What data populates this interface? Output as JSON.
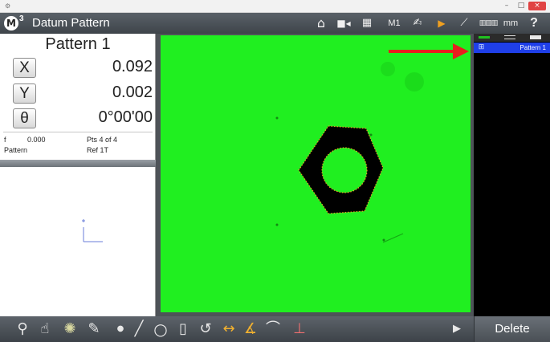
{
  "window": {
    "icon": "app-small-icon",
    "minimize": "–",
    "maximize": "□",
    "close": "×"
  },
  "title_bar": {
    "logo": "M",
    "logo_sup": "3",
    "title": "Datum Pattern",
    "m1": "M1",
    "unit": "mm",
    "help": "?",
    "icons": [
      "home-icon",
      "video-icon",
      "grid-icon",
      "probe-icon",
      "play-icon",
      "stylus-icon",
      "ruler-icon",
      "help-icon"
    ]
  },
  "dro": {
    "title": "Pattern 1",
    "x_label": "X",
    "x_value": "0.092",
    "y_label": "Y",
    "y_value": "0.002",
    "theta_label": "θ",
    "theta_value": "0°00'00"
  },
  "info": {
    "f_label": "f",
    "f_value": "0.000",
    "points": "Pts 4 of 4",
    "type": "Pattern",
    "ref": "Ref 1T"
  },
  "feature_list": {
    "items": [
      {
        "label": "Pattern 1",
        "icon": "pattern-grid-icon"
      }
    ]
  },
  "toolbar": {
    "delete_label": "Delete",
    "tools": [
      "zoom-icon",
      "hand-icon",
      "light-icon",
      "probe-pen-icon",
      "point-icon",
      "line-icon",
      "circle-icon",
      "slot-icon",
      "arc-icon",
      "distance-icon",
      "angle-icon",
      "arc2-icon",
      "origin-icon",
      "more-arrow-icon"
    ]
  },
  "colors": {
    "video_background": "#20ef20",
    "part": "#000000",
    "edge_points": "#e3a020",
    "annotation_arrow": "#e81e1e",
    "selection": "#1f3fe8"
  }
}
